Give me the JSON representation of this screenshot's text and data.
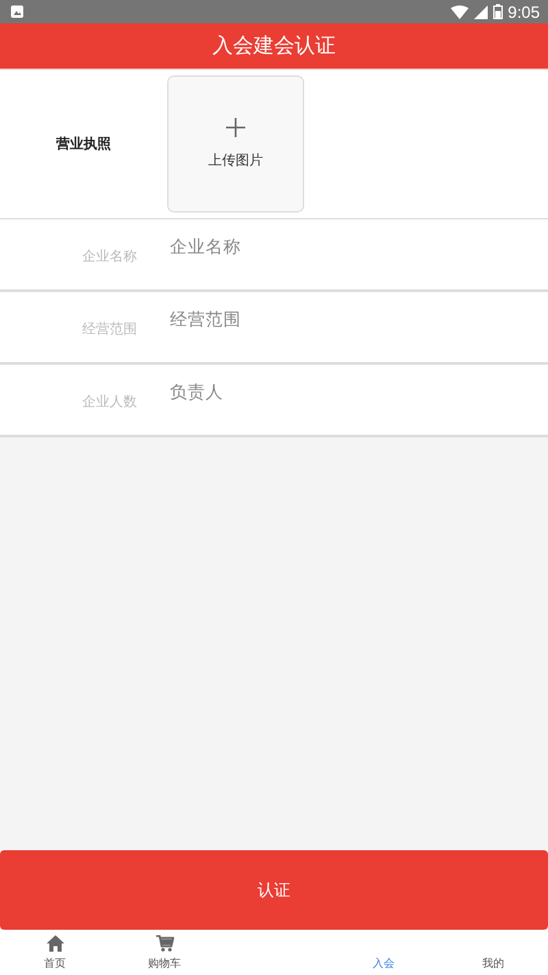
{
  "status_bar": {
    "time": "9:05"
  },
  "header": {
    "title": "入会建会认证"
  },
  "upload": {
    "label": "营业执照",
    "button": "上传图片"
  },
  "fields": [
    {
      "label": "企业名称",
      "placeholder": "企业名称"
    },
    {
      "label": "经营范围",
      "placeholder": "经营范围"
    },
    {
      "label": "企业人数",
      "placeholder": "负责人"
    }
  ],
  "submit": "认证",
  "tabs": [
    {
      "label": "首页",
      "kind": "home",
      "selected": false
    },
    {
      "label": "购物车",
      "kind": "cart",
      "selected": false
    },
    {
      "label": "入会",
      "kind": "plain",
      "selected": true
    },
    {
      "label": "我的",
      "kind": "plain",
      "selected": false
    }
  ]
}
